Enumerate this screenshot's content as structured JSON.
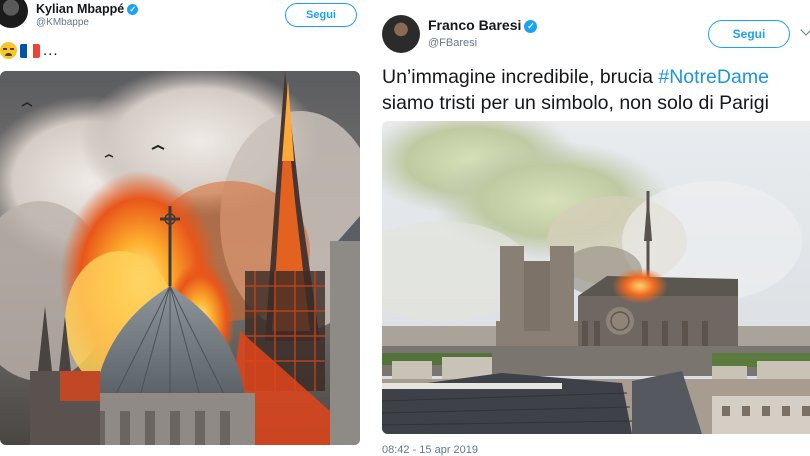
{
  "left_tweet": {
    "display_name": "Kylian Mbappé",
    "handle": "@KMbappe",
    "follow_label": "Segui",
    "text_suffix": "...",
    "emoji": [
      "crying-face-emoji",
      "france-flag-emoji"
    ],
    "image_caption": ""
  },
  "right_tweet": {
    "display_name": "Franco Baresi",
    "handle": "@FBaresi",
    "follow_label": "Segui",
    "text_line1_prefix": "Un’immagine incredibile, brucia ",
    "hashtag": "#NotreDame",
    "text_line2": "siamo tristi per un simbolo, non solo di Parigi",
    "timestamp": "08:42 - 15 apr 2019"
  },
  "colors": {
    "accent": "#1da1f2",
    "hashtag": "#1b95e0",
    "muted": "#657786",
    "flag_blue": "#0055a4",
    "flag_white": "#ffffff",
    "flag_red": "#ef4135"
  }
}
